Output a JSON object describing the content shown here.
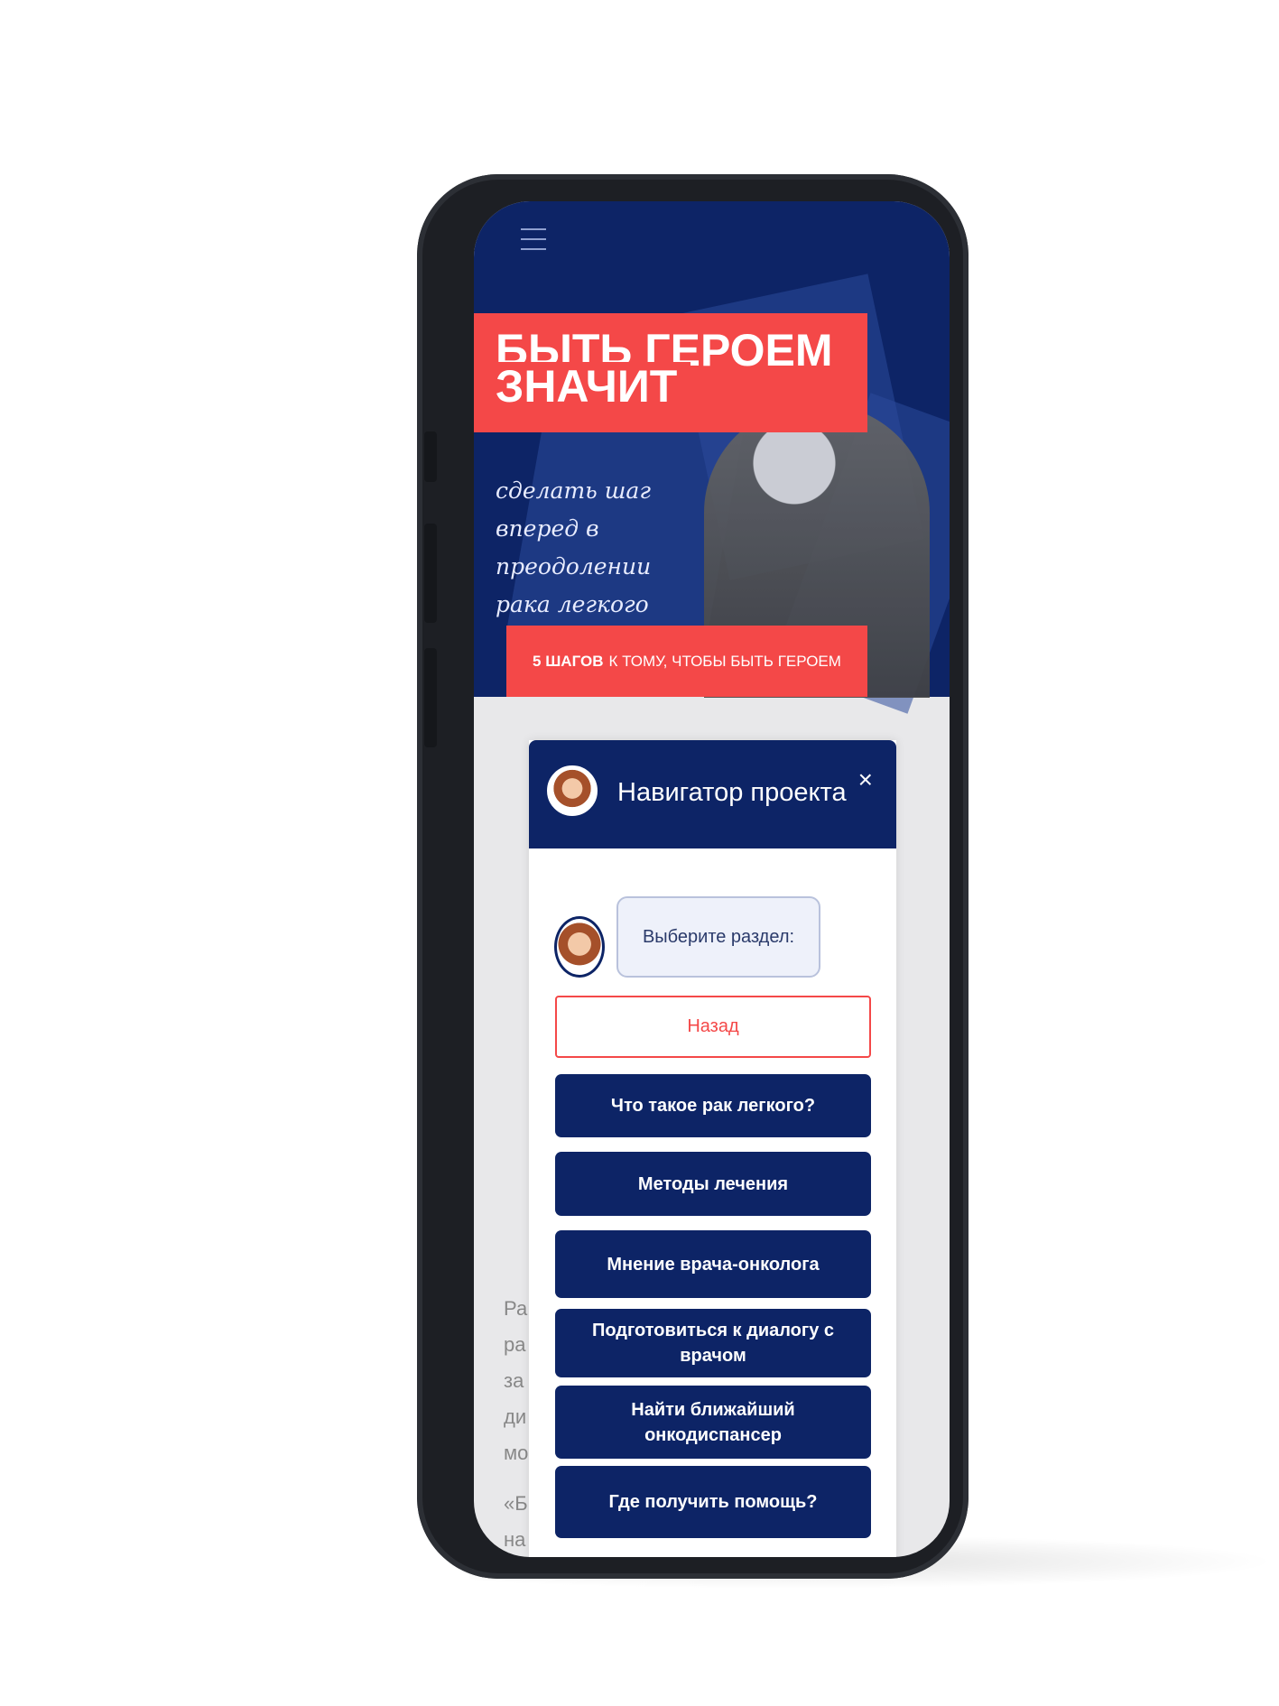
{
  "banner": {
    "title_line1": "БЫТЬ ГЕРОЕМ —",
    "title_line2": "ЗНАЧИТ",
    "subtitle": "сделать шаг вперед в преодолении рака легкого",
    "steps_bold": "5 ШАГОВ",
    "steps_rest": "К ТОМУ, ЧТОБЫ БЫТЬ ГЕРОЕМ"
  },
  "background_text": [
    "Ра",
    "ра",
    "за",
    "ди",
    "мо",
    "«Б",
    "на"
  ],
  "chat": {
    "title": "Навигатор проекта",
    "close": "×",
    "bot_message": "Выберите раздел:",
    "back_label": "Назад",
    "options": [
      "Что такое рак легкого?",
      "Методы лечения",
      "Мнение врача-онколога",
      "Подготовиться к диалогу с врачом",
      "Найти ближайший онкодиспансер",
      "Где получить помощь?"
    ]
  },
  "colors": {
    "navy": "#0d2466",
    "red": "#f44848"
  }
}
